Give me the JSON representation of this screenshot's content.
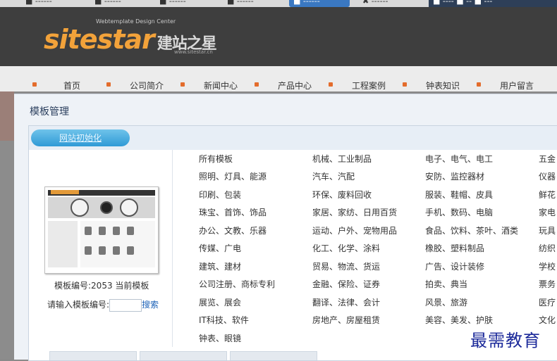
{
  "nav": {
    "items": [
      "首页",
      "公司简介",
      "新闻中心",
      "产品中心",
      "工程案例",
      "钟表知识",
      "用户留言"
    ]
  },
  "modal": {
    "title": "模板管理",
    "init_button": "网站初始化",
    "template_info": "模板编号:2053  当前模板",
    "input_label": "请输入模板编号:",
    "input_value": "",
    "search_label": "搜索"
  },
  "categories": {
    "col1": [
      "所有模板",
      "照明、灯具、能源",
      "印刷、包装",
      "珠宝、首饰、饰品",
      "办公、文教、乐器",
      "传媒、广电",
      "建筑、建材",
      "公司注册、商标专利",
      "展览、展会",
      "IT科技、软件",
      "钟表、眼镜"
    ],
    "col2": [
      "机械、工业制品",
      "汽车、汽配",
      "环保、废料回收",
      "家居、家纺、日用百货",
      "运动、户外、宠物用品",
      "化工、化学、涂料",
      "贸易、物流、货运",
      "金融、保险、证券",
      "翻译、法律、会计",
      "房地产、房屋租赁"
    ],
    "col3": [
      "电子、电气、电工",
      "安防、监控器材",
      "服装、鞋帽、皮具",
      "手机、数码、电脑",
      "食品、饮料、茶叶、酒类",
      "橡胶、塑料制品",
      "广告、设计装修",
      "拍卖、典当",
      "风景、旅游",
      "美容、美发、护肤"
    ],
    "col4": [
      "五金",
      "仪器",
      "鲜花",
      "家电",
      "玩具",
      "纺织",
      "学校",
      "票务",
      "医疗",
      "文化"
    ]
  },
  "watermark": "最需教育",
  "logo": {
    "brand": "sitestar",
    "brand_cn": "建站之星",
    "tagline": "Webtemplate Design Center",
    "url": "www.sitestar.cn"
  }
}
